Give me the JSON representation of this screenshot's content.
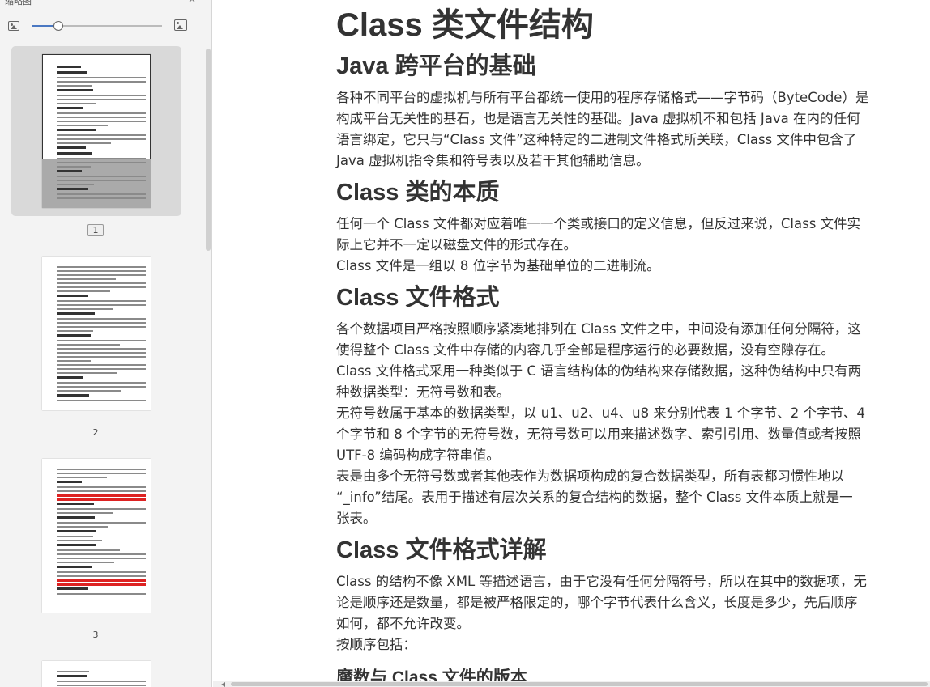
{
  "sidebar": {
    "title": "缩略图",
    "close_symbol": "×",
    "zoom": {
      "level": 0.2,
      "small_icon": "image-small-icon",
      "large_icon": "image-large-icon"
    },
    "pages": [
      {
        "number": "1",
        "selected": true
      },
      {
        "number": "2",
        "selected": false
      },
      {
        "number": "3",
        "selected": false
      }
    ]
  },
  "document": {
    "title": "Class 类文件结构",
    "sections": [
      {
        "heading": "Java 跨平台的基础",
        "lines": [
          "各种不同平台的虚拟机与所有平台都统一使用的程序存储格式——字节码（ByteCode）是",
          "构成平台无关性的基石，也是语言无关性的基础。Java 虚拟机不和包括 Java 在内的任何",
          "语言绑定，它只与“Class 文件”这种特定的二进制文件格式所关联，Class 文件中包含了",
          "Java 虚拟机指令集和符号表以及若干其他辅助信息。"
        ]
      },
      {
        "heading": "Class 类的本质",
        "lines": [
          "任何一个 Class 文件都对应着唯一一个类或接口的定义信息，但反过来说，Class 文件实",
          "际上它并不一定以磁盘文件的形式存在。",
          "Class 文件是一组以 8 位字节为基础单位的二进制流。"
        ]
      },
      {
        "heading": "Class 文件格式",
        "lines": [
          "各个数据项目严格按照顺序紧凑地排列在 Class 文件之中，中间没有添加任何分隔符，这",
          "使得整个 Class 文件中存储的内容几乎全部是程序运行的必要数据，没有空隙存在。",
          "Class 文件格式采用一种类似于 C 语言结构体的伪结构来存储数据，这种伪结构中只有两",
          "种数据类型：无符号数和表。",
          "无符号数属于基本的数据类型，以 u1、u2、u4、u8 来分别代表 1 个字节、2 个字节、4",
          "个字节和 8 个字节的无符号数，无符号数可以用来描述数字、索引引用、数量值或者按照",
          "UTF-8 编码构成字符串值。",
          "表是由多个无符号数或者其他表作为数据项构成的复合数据类型，所有表都习惯性地以",
          "“_info”结尾。表用于描述有层次关系的复合结构的数据，整个 Class 文件本质上就是一",
          "张表。"
        ]
      },
      {
        "heading": "Class 文件格式详解",
        "lines": [
          "Class 的结构不像 XML 等描述语言，由于它没有任何分隔符号，所以在其中的数据项，无",
          "论是顺序还是数量，都是被严格限定的，哪个字节代表什么含义，长度是多少，先后顺序",
          "如何，都不允许改变。",
          "按顺序包括："
        ]
      }
    ],
    "subheading": "魔数与 Class 文件的版本"
  }
}
